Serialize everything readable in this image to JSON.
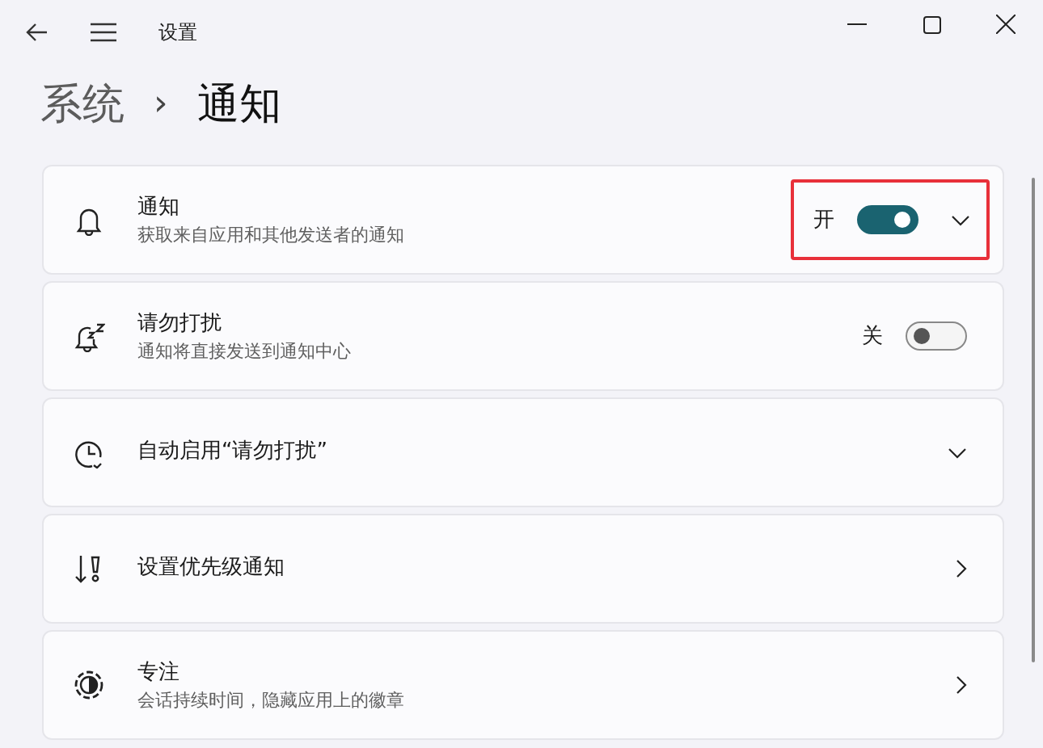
{
  "window": {
    "title": "设置"
  },
  "breadcrumb": {
    "parent": "系统",
    "separator": "›",
    "current": "通知"
  },
  "rows": [
    {
      "title": "通知",
      "subtitle": "获取来自应用和其他发送者的通知",
      "toggle": {
        "label": "开",
        "on": true
      },
      "kind": "expander",
      "highlighted": true
    },
    {
      "title": "请勿打扰",
      "subtitle": "通知将直接发送到通知中心",
      "toggle": {
        "label": "关",
        "on": false
      },
      "kind": "toggle",
      "highlighted": false
    },
    {
      "title": "自动启用“请勿打扰”",
      "kind": "expander",
      "highlighted": false
    },
    {
      "title": "设置优先级通知",
      "kind": "link",
      "highlighted": false
    },
    {
      "title": "专注",
      "subtitle": "会话持续时间，隐藏应用上的徽章",
      "kind": "link",
      "highlighted": false
    }
  ]
}
